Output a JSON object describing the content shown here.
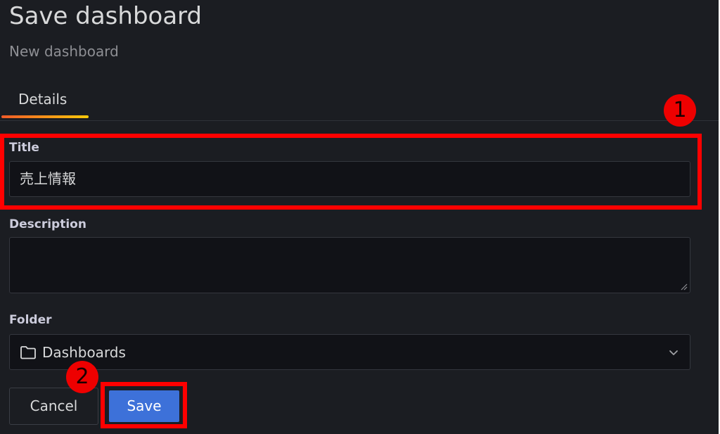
{
  "dialog": {
    "title": "Save dashboard",
    "subtitle": "New dashboard"
  },
  "tabs": [
    {
      "label": "Details",
      "active": true
    }
  ],
  "form": {
    "title": {
      "label": "Title",
      "value": "売上情報"
    },
    "description": {
      "label": "Description",
      "value": ""
    },
    "folder": {
      "label": "Folder",
      "value": "Dashboards",
      "icon": "folder-icon"
    }
  },
  "actions": {
    "cancel_label": "Cancel",
    "save_label": "Save"
  },
  "annotations": {
    "marker_1": "1",
    "marker_2": "2",
    "highlight_color": "#ff0000"
  },
  "colors": {
    "background": "#1b1d22",
    "input_background": "#111217",
    "primary_button": "#3d71d9",
    "tab_underline_start": "#f05a28",
    "tab_underline_end": "#fbca0a"
  }
}
